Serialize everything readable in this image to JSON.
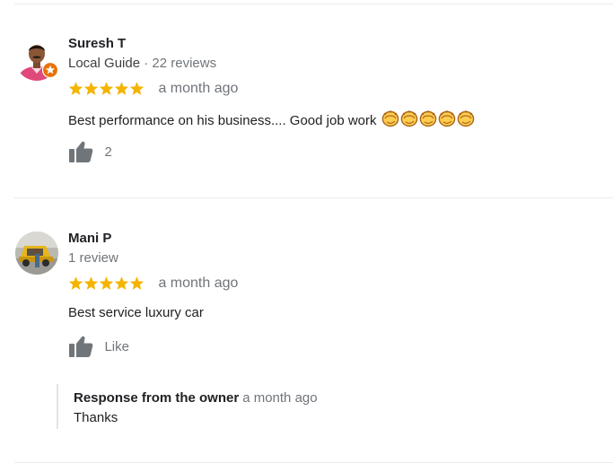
{
  "reviews": [
    {
      "reviewer_name": "Suresh T",
      "reviewer_badge": "Local Guide",
      "reviewer_stats": " · 22 reviews",
      "stars": 5,
      "time": "a month ago",
      "text": "Best performance on his business.... Good job work ",
      "emoji_count": 5,
      "like_label": "2",
      "avatar_icon": "person-photo",
      "badge_icon": "local-guide-star-icon"
    },
    {
      "reviewer_name": "Mani P",
      "reviewer_stats": "1 review",
      "stars": 5,
      "time": "a month ago",
      "text": "Best service luxury car",
      "like_label": "Like",
      "avatar_icon": "car-photo",
      "owner_response": {
        "title": "Response from the owner",
        "time": "a month ago",
        "text": "Thanks"
      }
    }
  ],
  "colors": {
    "star": "#f4b400",
    "icon_gray": "#70757a",
    "guide_badge": "#e8710a",
    "divider": "#ebebeb"
  }
}
